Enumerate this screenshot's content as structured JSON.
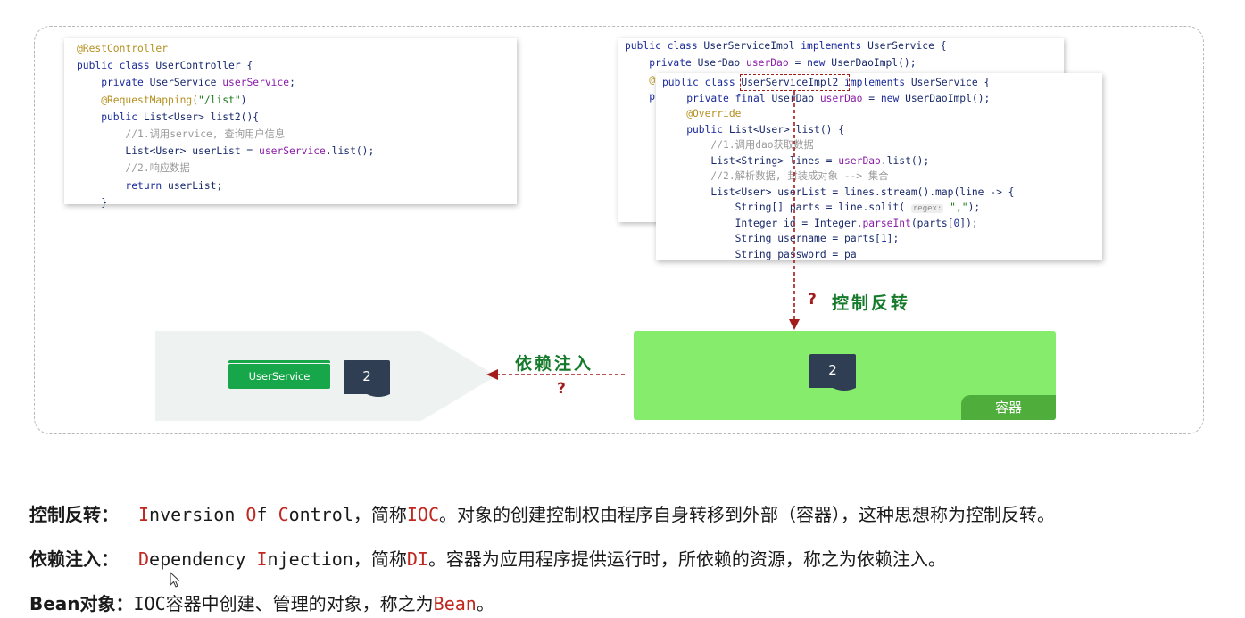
{
  "controller_code": {
    "lines": [
      {
        "segs": [
          {
            "t": "@RestController",
            "c": "ann"
          }
        ]
      },
      {
        "segs": [
          {
            "t": "public class ",
            "c": "kw"
          },
          {
            "t": "UserController {",
            "c": ""
          }
        ]
      },
      {
        "segs": [
          {
            "t": "    private ",
            "c": "kw"
          },
          {
            "t": "UserService ",
            "c": ""
          },
          {
            "t": "userService",
            "c": "fld"
          },
          {
            "t": ";",
            "c": ""
          }
        ]
      },
      {
        "segs": [
          {
            "t": "    @RequestMapping(",
            "c": "ann"
          },
          {
            "t": "\"/list\"",
            "c": "str"
          },
          {
            "t": ")",
            "c": ""
          }
        ]
      },
      {
        "segs": [
          {
            "t": "    public ",
            "c": "kw"
          },
          {
            "t": "List<User> list2(){",
            "c": ""
          }
        ]
      },
      {
        "segs": [
          {
            "t": "        //1.调用service, 查询用户信息",
            "c": "cmt"
          }
        ]
      },
      {
        "segs": [
          {
            "t": "        List<User> userList = ",
            "c": ""
          },
          {
            "t": "userService",
            "c": "fld"
          },
          {
            "t": ".list();",
            "c": ""
          }
        ]
      },
      {
        "segs": [
          {
            "t": "        //2.响应数据",
            "c": "cmt"
          }
        ]
      },
      {
        "segs": [
          {
            "t": "        return ",
            "c": "kw"
          },
          {
            "t": "userList;",
            "c": ""
          }
        ]
      },
      {
        "segs": [
          {
            "t": "    }",
            "c": ""
          }
        ]
      }
    ]
  },
  "impl_back_code": {
    "lines": [
      {
        "segs": [
          {
            "t": "public class ",
            "c": "kw"
          },
          {
            "t": "UserServiceImpl ",
            "c": ""
          },
          {
            "t": "implements ",
            "c": "kw"
          },
          {
            "t": "UserService {",
            "c": ""
          }
        ]
      },
      {
        "segs": [
          {
            "t": "    private ",
            "c": "kw"
          },
          {
            "t": "UserDao ",
            "c": ""
          },
          {
            "t": "userDao",
            "c": "fld"
          },
          {
            "t": " = ",
            "c": ""
          },
          {
            "t": "new ",
            "c": "kw"
          },
          {
            "t": "UserDaoImpl();",
            "c": ""
          }
        ]
      },
      {
        "segs": [
          {
            "t": "    @",
            "c": "ann"
          }
        ]
      },
      {
        "segs": [
          {
            "t": "    p",
            "c": "kw"
          }
        ]
      }
    ]
  },
  "impl2_code": {
    "lines": [
      {
        "segs": [
          {
            "t": "public class ",
            "c": "kw"
          },
          {
            "t": "UserServiceImpl2 ",
            "c": ""
          },
          {
            "t": "implements ",
            "c": "kw"
          },
          {
            "t": "UserService {",
            "c": ""
          }
        ]
      },
      {
        "segs": [
          {
            "t": "    private final ",
            "c": "kw"
          },
          {
            "t": "UserDao ",
            "c": ""
          },
          {
            "t": "userDao",
            "c": "fld"
          },
          {
            "t": " = ",
            "c": ""
          },
          {
            "t": "new ",
            "c": "kw"
          },
          {
            "t": "UserDaoImpl();",
            "c": ""
          }
        ]
      },
      {
        "segs": [
          {
            "t": "    @Override",
            "c": "ann"
          }
        ]
      },
      {
        "segs": [
          {
            "t": "    public ",
            "c": "kw"
          },
          {
            "t": "List<User> list() {",
            "c": ""
          }
        ]
      },
      {
        "segs": [
          {
            "t": "        //1.调用dao获取数据",
            "c": "cmt"
          }
        ]
      },
      {
        "segs": [
          {
            "t": "        List<String> lines = ",
            "c": ""
          },
          {
            "t": "userDao",
            "c": "fld"
          },
          {
            "t": ".list();",
            "c": ""
          }
        ]
      },
      {
        "segs": [
          {
            "t": "        //2.解析数据, 封装成对象 --> 集合",
            "c": "cmt"
          }
        ]
      },
      {
        "segs": [
          {
            "t": "        List<User> userList = lines.stream().map(line -> {",
            "c": ""
          }
        ]
      },
      {
        "segs": [
          {
            "t": "            String[] parts = line.split( ",
            "c": ""
          },
          {
            "t": "regex:",
            "c": "hint"
          },
          {
            "t": " \",\"",
            "c": "str"
          },
          {
            "t": ");",
            "c": ""
          }
        ]
      },
      {
        "segs": [
          {
            "t": "            Integer id = Integer.",
            "c": ""
          },
          {
            "t": "parseInt",
            "c": "fld"
          },
          {
            "t": "(parts[",
            "c": ""
          },
          {
            "t": "0",
            "c": "kw"
          },
          {
            "t": "]);",
            "c": ""
          }
        ]
      },
      {
        "segs": [
          {
            "t": "            String username = parts[",
            "c": ""
          },
          {
            "t": "1",
            "c": "kw"
          },
          {
            "t": "];",
            "c": ""
          }
        ]
      },
      {
        "segs": [
          {
            "t": "            String password = pa",
            "c": ""
          }
        ]
      }
    ]
  },
  "left_panel": {
    "userservice_label": "UserService",
    "doc_number": "2"
  },
  "right_panel": {
    "doc_number": "2",
    "container_label": "容器"
  },
  "ioc_annotation": {
    "question": "?",
    "label": "控制反转"
  },
  "di_annotation": {
    "label": "依赖注入",
    "question": "?"
  },
  "definitions": {
    "ioc": {
      "term": "控制反转：",
      "c1": "I",
      "t1": "nversion ",
      "c2": "O",
      "t2": "f ",
      "c3": "C",
      "t3": "ontrol",
      "t4": "，简称",
      "abbr": "IOC",
      "t5": "。对象的创建控制权由程序自身转移到外部（容器），这种思想称为控制反转。"
    },
    "di": {
      "term": "依赖注入：",
      "c1": "D",
      "t1": "ependency ",
      "c2": "I",
      "t2": "njection",
      "t3": "，简称",
      "abbr": "DI",
      "t4": "。容器为应用程序提供运行时，所依赖的资源，称之为依赖注入。"
    },
    "bean": {
      "term": "Bean对象：",
      "t1": "IOC容器中创建、管理的对象，称之为",
      "abbr": "Bean",
      "t2": "。"
    }
  },
  "colors": {
    "accent_red": "#c0271f",
    "green_panel": "#86ec6c",
    "green_tag": "#17a74a",
    "annotation_green": "#167a2b"
  }
}
